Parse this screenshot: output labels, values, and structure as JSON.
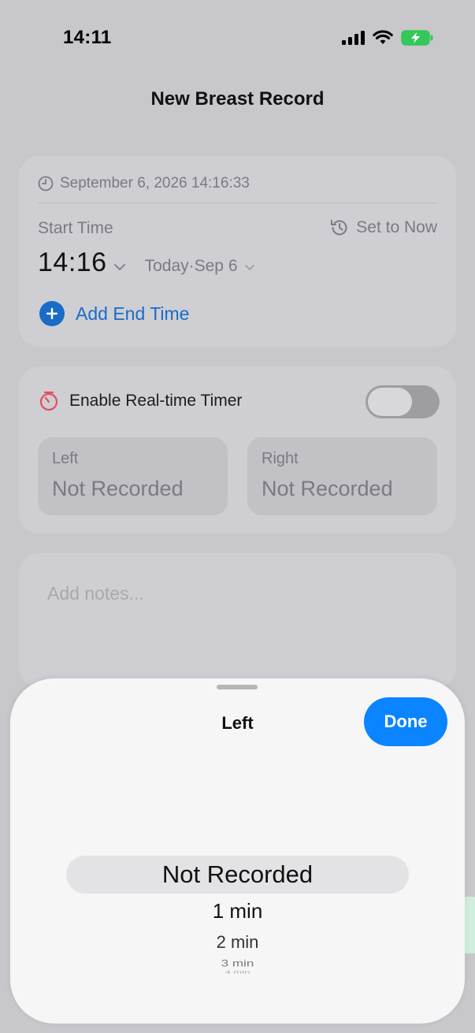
{
  "status_bar": {
    "time": "14:11"
  },
  "nav": {
    "title": "New Breast Record"
  },
  "time_card": {
    "record_timestamp": "September 6, 2026 14:16:33",
    "start_label": "Start Time",
    "set_now_label": "Set to Now",
    "start_time": "14:16",
    "start_date": "Today·Sep 6",
    "add_end_label": "Add End Time"
  },
  "timer_card": {
    "enable_label": "Enable Real-time Timer",
    "enabled": false,
    "left_label": "Left",
    "left_value": "Not Recorded",
    "right_label": "Right",
    "right_value": "Not Recorded"
  },
  "notes": {
    "placeholder": "Add notes..."
  },
  "sheet": {
    "title": "Left",
    "done_label": "Done",
    "options": [
      "Not Recorded",
      "1 min",
      "2 min",
      "3 min",
      "4 min"
    ],
    "selected": "Not Recorded"
  },
  "colors": {
    "accent": "#0a84ff",
    "link": "#1a6bc6",
    "timer_icon": "#e0505a",
    "battery_fill": "#34c759"
  }
}
